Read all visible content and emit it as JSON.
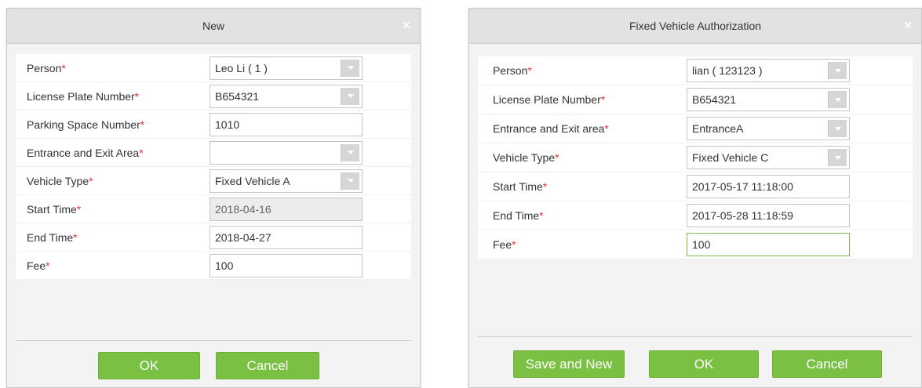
{
  "dialog1": {
    "title": "New",
    "close_glyph": "×",
    "required_mark": "*",
    "fields": {
      "person": {
        "label": "Person",
        "value": "Leo Li ( 1 )"
      },
      "license": {
        "label": "License Plate Number",
        "value": "B654321"
      },
      "parking": {
        "label": "Parking Space Number",
        "value": "1010"
      },
      "area": {
        "label": "Entrance and Exit Area",
        "value": ""
      },
      "vehicle_type": {
        "label": "Vehicle Type",
        "value": "Fixed Vehicle A"
      },
      "start_time": {
        "label": "Start Time",
        "value": "2018-04-16"
      },
      "end_time": {
        "label": "End Time",
        "value": "2018-04-27"
      },
      "fee": {
        "label": "Fee",
        "value": "100"
      }
    },
    "buttons": {
      "ok": "OK",
      "cancel": "Cancel"
    }
  },
  "dialog2": {
    "title": "Fixed Vehicle Authorization",
    "close_glyph": "×",
    "required_mark": "*",
    "fields": {
      "person": {
        "label": "Person",
        "value": "lian ( 123123 )"
      },
      "license": {
        "label": "License Plate Number",
        "value": "B654321"
      },
      "area": {
        "label": "Entrance and Exit area",
        "value": "EntranceA"
      },
      "vehicle_type": {
        "label": "Vehicle Type",
        "value": "Fixed Vehicle C"
      },
      "start_time": {
        "label": "Start Time",
        "value": "2017-05-17 11:18:00"
      },
      "end_time": {
        "label": "End Time",
        "value": "2017-05-28 11:18:59"
      },
      "fee": {
        "label": "Fee",
        "value": "100"
      }
    },
    "buttons": {
      "save_new": "Save and New",
      "ok": "OK",
      "cancel": "Cancel"
    }
  },
  "colors": {
    "button_green": "#7ac143",
    "required_red": "#e33333",
    "focus_border": "#7cbc44"
  },
  "icons": {
    "dropdown": "chevron-down-icon",
    "close": "close-icon"
  }
}
